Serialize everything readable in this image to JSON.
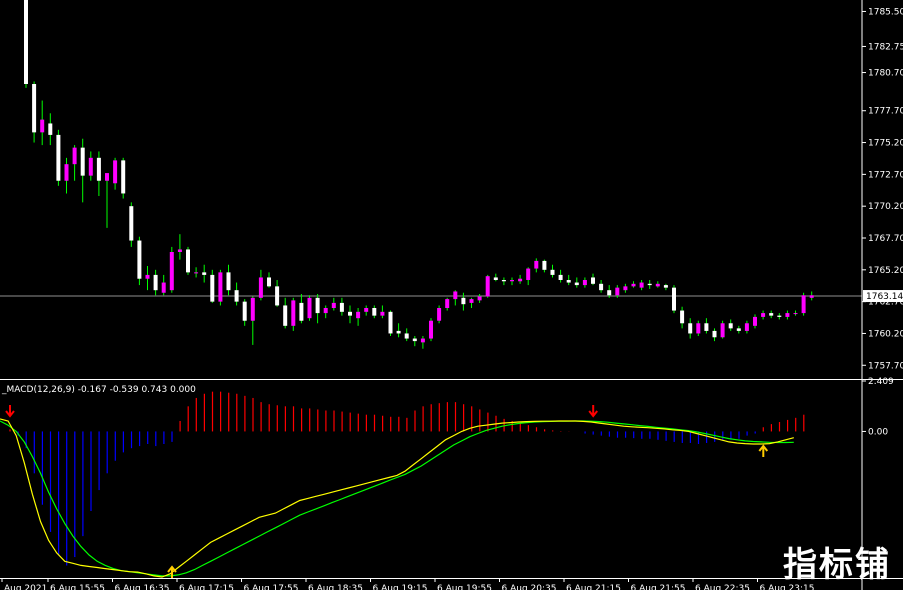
{
  "chart_data": [
    {
      "type": "candlestick",
      "price_ticks": [
        "1785.50",
        "1782.75",
        "1780.70",
        "1777.70",
        "1775.20",
        "1772.70",
        "1770.20",
        "1767.70",
        "1765.20",
        "1762.70",
        "1760.20",
        "1757.70"
      ],
      "current_price": "1763.14",
      "ylim": [
        1756.7,
        1786.4
      ],
      "time_ticks": [
        "Aug 2021",
        "6 Aug 15:55",
        "6 Aug 16:35",
        "6 Aug 17:15",
        "6 Aug 17:55",
        "6 Aug 18:35",
        "6 Aug 19:15",
        "6 Aug 19:55",
        "6 Aug 20:35",
        "6 Aug 21:15",
        "6 Aug 21:55",
        "6 Aug 22:35",
        "6 Aug 23:15"
      ],
      "colors": {
        "bull": "#ff00ff",
        "bear": "#ffffff",
        "wick": "#00ff00",
        "price_line": "#c0c0c0"
      },
      "candles": [
        [
          1786.5,
          1788.0,
          1779.5,
          1779.8
        ],
        [
          1779.8,
          1780.0,
          1775.2,
          1776.0
        ],
        [
          1776.0,
          1778.5,
          1775.0,
          1777.0
        ],
        [
          1776.7,
          1777.5,
          1775.0,
          1775.8
        ],
        [
          1775.8,
          1776.2,
          1771.8,
          1772.2
        ],
        [
          1772.2,
          1774.0,
          1771.2,
          1773.5
        ],
        [
          1773.5,
          1775.0,
          1772.2,
          1774.8
        ],
        [
          1774.8,
          1775.5,
          1770.5,
          1772.6
        ],
        [
          1772.6,
          1774.5,
          1772.2,
          1774.0
        ],
        [
          1774.0,
          1774.5,
          1771.0,
          1772.2
        ],
        [
          1772.2,
          1772.8,
          1768.5,
          1772.8
        ],
        [
          1772.0,
          1774.0,
          1771.5,
          1773.8
        ],
        [
          1773.8,
          1774.0,
          1770.8,
          1771.2
        ],
        [
          1770.2,
          1770.5,
          1767.0,
          1767.5
        ],
        [
          1767.5,
          1767.8,
          1764.0,
          1764.5
        ],
        [
          1764.5,
          1765.5,
          1763.6,
          1764.8
        ],
        [
          1764.8,
          1765.2,
          1763.2,
          1763.6
        ],
        [
          1763.4,
          1764.8,
          1763.2,
          1764.2
        ],
        [
          1763.6,
          1767.0,
          1763.4,
          1766.6
        ],
        [
          1766.6,
          1768.0,
          1766.0,
          1766.8
        ],
        [
          1766.8,
          1767.0,
          1764.8,
          1765.0
        ],
        [
          1765.0,
          1765.4,
          1764.6,
          1765.0
        ],
        [
          1765.0,
          1765.6,
          1764.2,
          1764.8
        ],
        [
          1764.8,
          1765.2,
          1762.6,
          1762.7
        ],
        [
          1762.7,
          1765.2,
          1762.4,
          1765.0
        ],
        [
          1765.0,
          1765.6,
          1763.2,
          1763.6
        ],
        [
          1763.6,
          1764.2,
          1762.4,
          1762.7
        ],
        [
          1762.7,
          1762.9,
          1760.8,
          1761.2
        ],
        [
          1761.2,
          1763.1,
          1759.3,
          1763.0
        ],
        [
          1763.0,
          1765.2,
          1762.8,
          1764.6
        ],
        [
          1764.6,
          1765.0,
          1763.8,
          1763.9
        ],
        [
          1763.9,
          1764.4,
          1762.3,
          1762.4
        ],
        [
          1762.4,
          1763.0,
          1760.6,
          1760.8
        ],
        [
          1760.8,
          1763.0,
          1760.4,
          1762.8
        ],
        [
          1762.6,
          1763.3,
          1761.0,
          1761.2
        ],
        [
          1761.4,
          1763.2,
          1761.2,
          1763.0
        ],
        [
          1763.0,
          1763.3,
          1761.0,
          1761.8
        ],
        [
          1761.8,
          1762.4,
          1761.4,
          1762.2
        ],
        [
          1762.2,
          1763.0,
          1762.0,
          1762.6
        ],
        [
          1762.6,
          1763.0,
          1761.6,
          1761.9
        ],
        [
          1761.9,
          1762.4,
          1761.0,
          1761.6
        ],
        [
          1761.4,
          1762.2,
          1760.8,
          1761.9
        ],
        [
          1761.9,
          1762.4,
          1761.6,
          1762.2
        ],
        [
          1762.2,
          1762.4,
          1761.4,
          1761.6
        ],
        [
          1761.6,
          1762.4,
          1761.4,
          1761.9
        ],
        [
          1761.9,
          1762.0,
          1760.0,
          1760.2
        ],
        [
          1760.4,
          1761.0,
          1759.9,
          1760.2
        ],
        [
          1760.2,
          1760.6,
          1759.6,
          1759.8
        ],
        [
          1759.8,
          1760.0,
          1759.2,
          1759.6
        ],
        [
          1759.5,
          1760.0,
          1759.0,
          1759.8
        ],
        [
          1759.8,
          1761.4,
          1759.6,
          1761.2
        ],
        [
          1761.2,
          1762.4,
          1761.0,
          1762.2
        ],
        [
          1762.2,
          1763.0,
          1762.0,
          1762.9
        ],
        [
          1762.9,
          1763.6,
          1762.4,
          1763.5
        ],
        [
          1763.0,
          1763.4,
          1762.0,
          1762.5
        ],
        [
          1762.6,
          1763.0,
          1762.2,
          1762.9
        ],
        [
          1762.8,
          1763.3,
          1762.6,
          1763.1
        ],
        [
          1763.1,
          1764.8,
          1763.0,
          1764.7
        ],
        [
          1764.6,
          1764.9,
          1764.3,
          1764.4
        ],
        [
          1764.4,
          1764.6,
          1764.0,
          1764.3
        ],
        [
          1764.3,
          1764.6,
          1764.0,
          1764.4
        ],
        [
          1764.3,
          1764.8,
          1764.1,
          1764.5
        ],
        [
          1764.4,
          1765.4,
          1764.0,
          1765.3
        ],
        [
          1765.3,
          1766.1,
          1765.0,
          1765.9
        ],
        [
          1765.9,
          1766.0,
          1765.0,
          1765.2
        ],
        [
          1765.2,
          1765.6,
          1764.6,
          1764.8
        ],
        [
          1764.8,
          1765.2,
          1764.2,
          1764.4
        ],
        [
          1764.4,
          1764.8,
          1764.0,
          1764.2
        ],
        [
          1764.2,
          1764.6,
          1763.8,
          1764.0
        ],
        [
          1764.0,
          1764.6,
          1763.8,
          1764.4
        ],
        [
          1764.6,
          1764.9,
          1764.0,
          1764.1
        ],
        [
          1764.1,
          1764.4,
          1763.4,
          1763.6
        ],
        [
          1763.6,
          1764.0,
          1763.0,
          1763.2
        ],
        [
          1763.2,
          1764.0,
          1763.0,
          1763.8
        ],
        [
          1763.6,
          1764.1,
          1763.4,
          1763.9
        ],
        [
          1763.9,
          1764.3,
          1763.8,
          1764.1
        ],
        [
          1763.8,
          1764.4,
          1763.6,
          1764.2
        ],
        [
          1764.1,
          1764.4,
          1763.7,
          1764.0
        ],
        [
          1763.9,
          1764.3,
          1763.8,
          1764.1
        ],
        [
          1764.0,
          1764.1,
          1763.6,
          1763.8
        ],
        [
          1763.8,
          1764.0,
          1761.8,
          1762.0
        ],
        [
          1762.0,
          1762.3,
          1760.6,
          1761.0
        ],
        [
          1761.0,
          1761.4,
          1759.8,
          1760.2
        ],
        [
          1760.2,
          1761.2,
          1760.0,
          1761.0
        ],
        [
          1761.0,
          1761.4,
          1760.2,
          1760.4
        ],
        [
          1760.4,
          1760.6,
          1759.6,
          1759.9
        ],
        [
          1759.9,
          1761.2,
          1759.8,
          1761.0
        ],
        [
          1761.0,
          1761.3,
          1760.4,
          1760.6
        ],
        [
          1760.6,
          1760.8,
          1760.2,
          1760.4
        ],
        [
          1760.4,
          1761.2,
          1760.2,
          1761.0
        ],
        [
          1760.8,
          1761.7,
          1760.6,
          1761.5
        ],
        [
          1761.5,
          1762.0,
          1761.3,
          1761.8
        ],
        [
          1761.8,
          1762.0,
          1761.4,
          1761.6
        ],
        [
          1761.6,
          1761.8,
          1761.3,
          1761.5
        ],
        [
          1761.5,
          1762.0,
          1761.3,
          1761.8
        ],
        [
          1761.8,
          1762.0,
          1761.6,
          1761.8
        ],
        [
          1761.8,
          1763.4,
          1761.6,
          1763.2
        ],
        [
          1763.0,
          1763.5,
          1762.8,
          1763.2
        ]
      ]
    },
    {
      "type": "macd",
      "label": "_MACD(12,26,9) -0.167 -0.539 0.743 0.000",
      "ticks": [
        "2.409",
        "0.00"
      ],
      "ylim": [
        -7.0,
        2.409
      ],
      "colors": {
        "hist_up": "#ff0000",
        "hist_down": "#0000ff",
        "macd": "#ffff00",
        "signal": "#00ff00",
        "arrow_down": "#ff0000",
        "arrow_up": "#ffcc00"
      },
      "macd": [
        0.6,
        0.5,
        -0.2,
        -1.5,
        -3.0,
        -4.3,
        -5.2,
        -5.8,
        -6.2,
        -6.3,
        -6.4,
        -6.45,
        -6.5,
        -6.55,
        -6.6,
        -6.65,
        -6.7,
        -6.72,
        -6.8,
        -6.9,
        -6.95,
        -6.8,
        -6.5,
        -6.2,
        -5.9,
        -5.6,
        -5.3,
        -5.1,
        -4.9,
        -4.7,
        -4.5,
        -4.3,
        -4.1,
        -4.0,
        -3.9,
        -3.7,
        -3.5,
        -3.3,
        -3.2,
        -3.1,
        -3.0,
        -2.9,
        -2.8,
        -2.7,
        -2.6,
        -2.5,
        -2.4,
        -2.3,
        -2.2,
        -2.1,
        -1.9,
        -1.6,
        -1.3,
        -1.0,
        -0.7,
        -0.4,
        -0.2,
        0.0,
        0.15,
        0.25,
        0.3,
        0.35,
        0.4,
        0.42,
        0.45,
        0.47,
        0.48,
        0.49,
        0.49,
        0.5,
        0.5,
        0.5,
        0.48,
        0.45,
        0.4,
        0.35,
        0.3,
        0.25,
        0.22,
        0.2,
        0.18,
        0.15,
        0.12,
        0.08,
        0.05,
        0.0,
        -0.1,
        -0.2,
        -0.3,
        -0.4,
        -0.5,
        -0.55,
        -0.58,
        -0.6,
        -0.6,
        -0.58,
        -0.5,
        -0.4,
        -0.3
      ],
      "signal": [
        0.5,
        0.3,
        0.0,
        -0.5,
        -1.2,
        -2.0,
        -2.9,
        -3.7,
        -4.4,
        -5.0,
        -5.5,
        -5.9,
        -6.2,
        -6.4,
        -6.55,
        -6.65,
        -6.7,
        -6.75,
        -6.8,
        -6.85,
        -6.9,
        -6.9,
        -6.85,
        -6.75,
        -6.6,
        -6.4,
        -6.2,
        -6.0,
        -5.8,
        -5.6,
        -5.4,
        -5.2,
        -5.0,
        -4.8,
        -4.6,
        -4.4,
        -4.2,
        -4.0,
        -3.85,
        -3.7,
        -3.55,
        -3.4,
        -3.25,
        -3.1,
        -2.95,
        -2.8,
        -2.65,
        -2.5,
        -2.35,
        -2.2,
        -2.05,
        -1.85,
        -1.65,
        -1.4,
        -1.15,
        -0.9,
        -0.65,
        -0.45,
        -0.25,
        -0.1,
        0.05,
        0.15,
        0.25,
        0.32,
        0.38,
        0.42,
        0.45,
        0.47,
        0.48,
        0.49,
        0.49,
        0.5,
        0.5,
        0.49,
        0.47,
        0.44,
        0.4,
        0.36,
        0.32,
        0.28,
        0.24,
        0.2,
        0.16,
        0.12,
        0.08,
        0.04,
        -0.02,
        -0.1,
        -0.18,
        -0.26,
        -0.34,
        -0.4,
        -0.45,
        -0.48,
        -0.5,
        -0.52,
        -0.53,
        -0.53,
        -0.52
      ],
      "histogram": [
        0.1,
        -0.2,
        -0.8,
        -2.0,
        -3.5,
        -4.8,
        -5.9,
        -6.4,
        -6.0,
        -5.0,
        -3.8,
        -2.8,
        -2.0,
        -1.4,
        -1.0,
        -0.8,
        -0.7,
        -0.6,
        -0.7,
        -0.6,
        -0.5,
        0.5,
        1.2,
        1.6,
        1.8,
        1.9,
        1.9,
        1.85,
        1.8,
        1.7,
        1.6,
        1.4,
        1.3,
        1.25,
        1.2,
        1.2,
        1.1,
        1.1,
        1.05,
        1.0,
        1.0,
        0.95,
        0.9,
        0.85,
        0.8,
        0.8,
        0.75,
        0.7,
        0.7,
        0.65,
        1.0,
        1.2,
        1.3,
        1.35,
        1.4,
        1.4,
        1.3,
        1.2,
        1.05,
        0.9,
        0.75,
        0.6,
        0.5,
        0.4,
        0.3,
        0.2,
        0.1,
        0.05,
        0.02,
        0.01,
        0.0,
        -0.1,
        -0.15,
        -0.2,
        -0.25,
        -0.3,
        -0.3,
        -0.32,
        -0.35,
        -0.35,
        -0.4,
        -0.45,
        -0.5,
        -0.55,
        -0.55,
        -0.6,
        -0.55,
        -0.5,
        -0.45,
        -0.4,
        -0.35,
        -0.2,
        -0.1,
        0.2,
        0.35,
        0.45,
        0.55,
        0.65,
        0.8
      ],
      "arrows_down_at": [
        0,
        72
      ],
      "arrows_up_at": [
        20,
        93
      ]
    }
  ],
  "watermark": "指标铺"
}
